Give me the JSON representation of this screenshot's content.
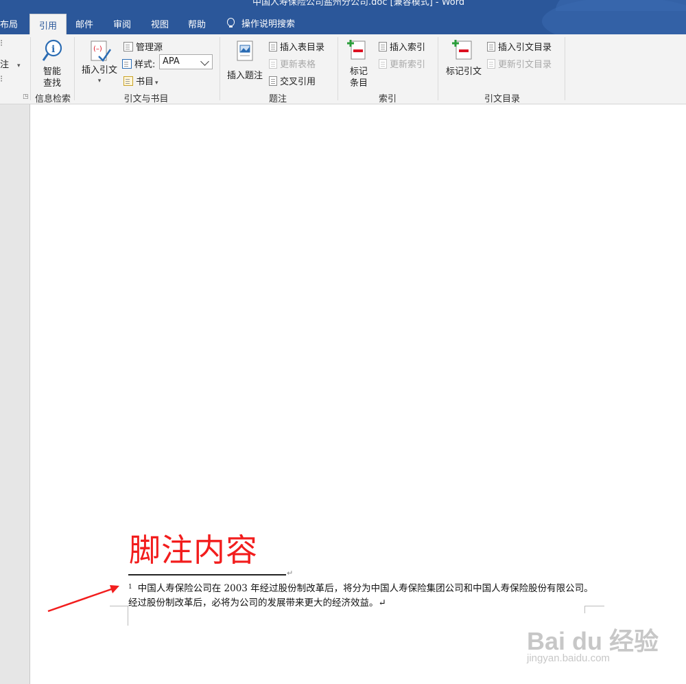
{
  "window": {
    "title": "中国人寿保险公司盐州分公司.doc [兼容模式] - Word"
  },
  "tabs": [
    {
      "label": "布局"
    },
    {
      "label": "引用"
    },
    {
      "label": "邮件"
    },
    {
      "label": "审阅"
    },
    {
      "label": "视图"
    },
    {
      "label": "帮助"
    }
  ],
  "tellme": {
    "label": "操作说明搜索"
  },
  "ribbon": {
    "footnote_group_partial": {
      "label_insert_note": "注"
    },
    "research": {
      "smart_lookup_line1": "智能",
      "smart_lookup_line2": "查找",
      "group_label": "信息检索"
    },
    "citations": {
      "insert_citation": "插入引文",
      "manage_sources": "管理源",
      "style_label": "样式:",
      "style_value": "APA",
      "bibliography": "书目",
      "group_label": "引文与书目"
    },
    "captions": {
      "insert_caption": "插入题注",
      "insert_table_of_figures": "插入表目录",
      "update_table": "更新表格",
      "cross_reference": "交叉引用",
      "group_label": "题注"
    },
    "index": {
      "mark_entry_line1": "标记",
      "mark_entry_line2": "条目",
      "insert_index": "插入索引",
      "update_index": "更新索引",
      "group_label": "索引"
    },
    "toa": {
      "mark_citation": "标记引文",
      "insert_toa": "插入引文目录",
      "update_toa": "更新引文目录",
      "group_label": "引文目录"
    }
  },
  "document": {
    "annotation": "脚注内容",
    "footnote_number": "1",
    "footnote_text": "中国人寿保险公司在 2003 年经过股份制改革后，将分为中国人寿保险集团公司和中国人寿保险股份有限公司。经过股份制改革后，必将为公司的发展带来更大的经济效益。↵",
    "para_mark": "↵"
  },
  "watermark": {
    "main": "Bai du 经验",
    "sub": "jingyan.baidu.com"
  },
  "colors": {
    "titlebar": "#2b579a",
    "annotation": "#f21d1d",
    "arrow": "#f21d1d"
  }
}
